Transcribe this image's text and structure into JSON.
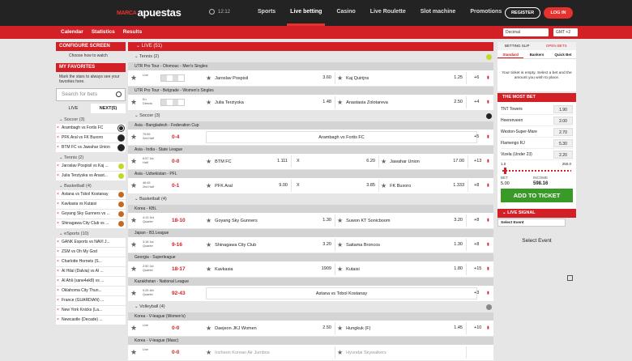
{
  "header": {
    "logo_prefix": "MARCA",
    "logo": "apuestas",
    "time": "12:12",
    "nav": [
      "Sports",
      "Live betting",
      "Casino",
      "Live Roulette",
      "Slot machine",
      "Promotions"
    ],
    "register": "REGISTER",
    "login": "LOG IN"
  },
  "subnav": {
    "items": [
      "Calendar",
      "Statistics",
      "Results"
    ],
    "odds_format": "Decimal",
    "timezone": "GMT +2"
  },
  "left": {
    "configure_title": "CONFIGURE SCREEN",
    "configure_text": "Choose how to watch",
    "favorites_title": "MY FAVORITES",
    "favorites_text": "Mark the stars to always see your favorites here.",
    "search_placeholder": "Search for bets",
    "tab_live": "LIVE",
    "tab_next": "NEXT(5)",
    "soccer_label": "Soccer (3)",
    "soccer": [
      "Arambagh vs Fortis FC",
      "PFK Aral vs FK Buxoro",
      "BTM FC vs Jawahar Union"
    ],
    "tennis_label": "Tennis (2)",
    "tennis": [
      "Jaroslav Pospisil vs Kaj ...",
      "Julia Terziyska vs Anast..."
    ],
    "basketball_label": "Basketball (4)",
    "basketball": [
      "Astana vs Tobol Kostanay",
      "Kavkasia vs Kutaisi",
      "Goyang Sky Gunners vs ...",
      "Shinagawa City Club vs ..."
    ],
    "esports_label": "eSports (10)",
    "esports": [
      "GANK Esports vs NAVI J...",
      "ZSM vs Oh My God",
      "Charlotte Hornets (S...",
      "Al Hilal (Dalvia) vs Al ...",
      "Al Ahli (sane4ek8) vs ...",
      "Oklahoma City Thun...",
      "France (GUARDIAN) ...",
      "New York Knicks (La...",
      "Newcastle (Decade) ..."
    ]
  },
  "main": {
    "live_label": "LIVE (51)",
    "tennis_label": "Tennis (2)",
    "leagues": {
      "t1": "UTR Pro Tour - Olomouc - Men's Singles",
      "t2": "UTR Pro Tour - Belgrade - Women's Singles",
      "s1": "Asia - Bangladesh - Federation Cup",
      "s2": "Asia - India - State League",
      "s3": "Asia - Uzbekistan - PFL",
      "b1": "Korea - KBL",
      "b2": "Japan - B3.League",
      "b3": "Georgia - Superleague",
      "b4": "Kazakhstan - National League",
      "v1": "Korea - V-league (Women's)",
      "v2": "Korea - V-league (Masc)"
    },
    "soccer_label": "Soccer (3)",
    "basketball_label": "Basketball (4)",
    "volleyball_label": "Volleyball (4)",
    "matches": [
      {
        "time": "Live",
        "home": "Jaroslav Pospisil",
        "h_odd": "3.60",
        "away": "Kaj Quirijns",
        "a_odd": "1.25",
        "more": "+6"
      },
      {
        "time": "En Directo",
        "home": "Julia Terziyska",
        "h_odd": "1.48",
        "away": "Anastasia Zolotareva",
        "a_odd": "2.50",
        "more": "+4"
      },
      {
        "time": "79:55 2nd Half",
        "score": "0-4",
        "event": "Arambagh vs Fortis FC",
        "more": "+5"
      },
      {
        "time": "6:57 1st Half",
        "score": "0-0",
        "home": "BTM FC",
        "h_odd": "1.111",
        "draw": "X",
        "d_odd": "6.20",
        "away": "Jawahar Union",
        "a_odd": "17.00",
        "more": "+13"
      },
      {
        "time": "46:45 2nd Half",
        "score": "0-1",
        "home": "PFK Aral",
        "h_odd": "9.00",
        "draw": "X",
        "d_odd": "3.85",
        "away": "FK Buxoro",
        "a_odd": "1.333",
        "more": "+8"
      },
      {
        "time": "4:13 3rd Quarter",
        "score": "18-10",
        "home": "Goyang Sky Gunners",
        "h_odd": "1.30",
        "away": "Suwon KT Sonicboom",
        "a_odd": "3.20",
        "more": "+8"
      },
      {
        "time": "3:18 1st Quarter",
        "score": "9-16",
        "home": "Shinagawa City Club",
        "h_odd": "3.20",
        "away": "Saitama Broncos",
        "a_odd": "1.30",
        "more": "+8"
      },
      {
        "time": "2:50 1st Quarter",
        "score": "18-17",
        "home": "Kavkasia",
        "h_odd": "1909",
        "away": "Kutaisi",
        "a_odd": "1.80",
        "more": "+15"
      },
      {
        "time": "9:25 4th Quarter",
        "score": "92-43",
        "event": "Astana vs Tobol Kostanay",
        "more": "+3"
      },
      {
        "time": "Live",
        "score": "0-0",
        "home": "Daejeon JKJ Women",
        "h_odd": "2.50",
        "away": "Hungkuk (F)",
        "a_odd": "1.45",
        "more": "+10"
      },
      {
        "time": "Live",
        "score": "0-0",
        "home": "Incheon Korean Air Jumbos",
        "h_odd": "",
        "away": "Hyundai Skywalkers",
        "a_odd": "",
        "more": ""
      }
    ]
  },
  "right": {
    "tab_slip": "BETTING SLIP",
    "tab_open": "OPEN BETS",
    "sub_standard": "Standard",
    "sub_bankers": "Bankers",
    "sub_quick": "Quick Bet",
    "empty_text1": "Your ticket is empty. Select a bet and the",
    "empty_text2": "amount you wish to place.",
    "most_title": "THE MOST BET",
    "most": [
      {
        "name": "TNT Towers",
        "odd": "1.90"
      },
      {
        "name": "Heerenveen",
        "odd": "2.00"
      },
      {
        "name": "Weston-Super-Mare",
        "odd": "2.70"
      },
      {
        "name": "Flamengo RJ",
        "odd": "5.30"
      },
      {
        "name": "Vizela (Under 23)",
        "odd": "2.20"
      }
    ],
    "slider_min": "1.0",
    "slider_max": "250.0",
    "slider_value": 0.02,
    "bet_label": "BET",
    "bet_value": "5.00",
    "income_label": "INCOME",
    "income_value": "598.16",
    "add_button": "ADD TO TICKET",
    "live_signal": "LIVE SIGNAL",
    "select_event": "Select Event",
    "select_event_text": "Select Event"
  },
  "colors": {
    "brand_red": "#d32026",
    "green": "#3a9a28",
    "topbar": "#232323"
  }
}
